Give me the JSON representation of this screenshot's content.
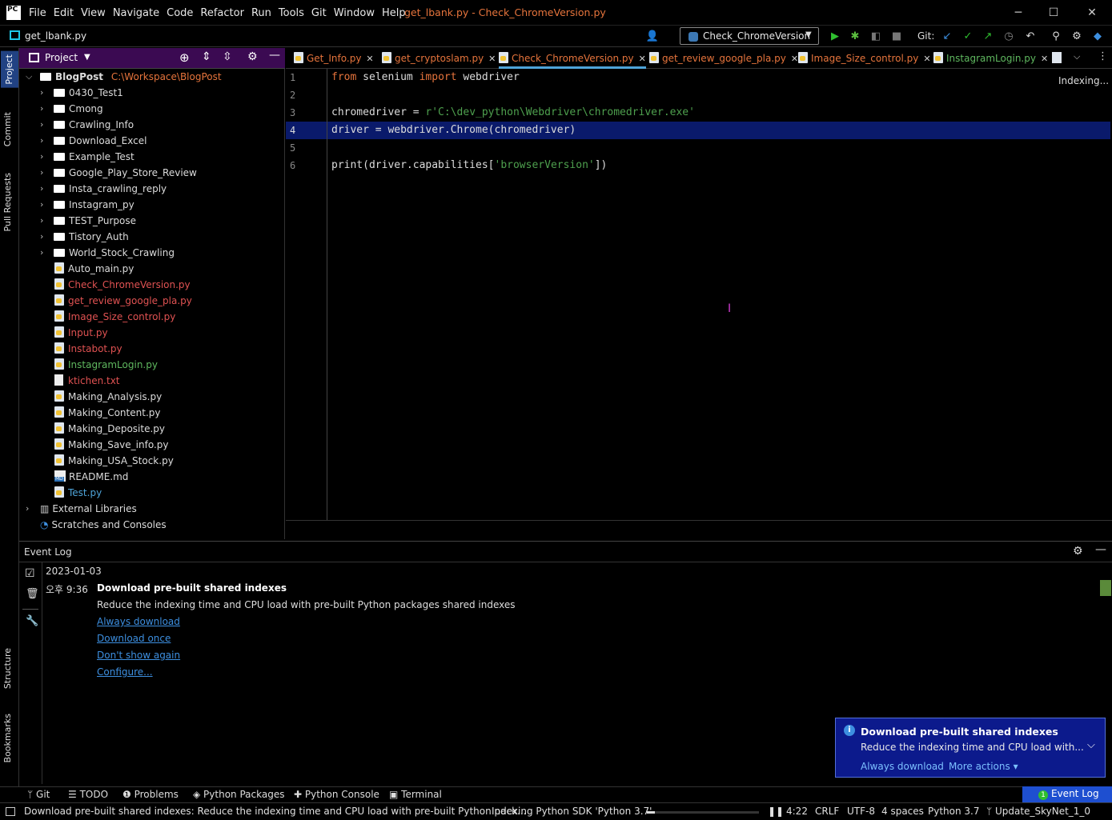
{
  "app": {
    "logo": "PC",
    "window_title": "get_lbank.py - Check_ChromeVersion.py",
    "menu": [
      "File",
      "Edit",
      "View",
      "Navigate",
      "Code",
      "Refactor",
      "Run",
      "Tools",
      "Git",
      "Window",
      "Help"
    ]
  },
  "navbar": {
    "current_file": "get_lbank.py",
    "run_config": "Check_ChromeVersion",
    "git_label": "Git:"
  },
  "left_strip": {
    "project": "Project",
    "commit": "Commit",
    "pull_requests": "Pull Requests",
    "structure": "Structure",
    "bookmarks": "Bookmarks"
  },
  "project_panel": {
    "title": "Project",
    "root_name": "BlogPost",
    "root_path": "C:\\Workspace\\BlogPost",
    "folders": [
      "0430_Test1",
      "Cmong",
      "Crawling_Info",
      "Download_Excel",
      "Example_Test",
      "Google_Play_Store_Review",
      "Insta_crawling_reply",
      "Instagram_py",
      "TEST_Purpose",
      "Tistory_Auth",
      "World_Stock_Crawling"
    ],
    "files": [
      {
        "name": "Auto_main.py",
        "color": "#dcdcdc",
        "kind": "py"
      },
      {
        "name": "Check_ChromeVersion.py",
        "color": "#e05252",
        "kind": "py"
      },
      {
        "name": "get_review_google_pla.py",
        "color": "#e05252",
        "kind": "py"
      },
      {
        "name": "Image_Size_control.py",
        "color": "#e05252",
        "kind": "py"
      },
      {
        "name": "Input.py",
        "color": "#e05252",
        "kind": "py"
      },
      {
        "name": "Instabot.py",
        "color": "#e05252",
        "kind": "py"
      },
      {
        "name": "InstagramLogin.py",
        "color": "#5fb85f",
        "kind": "py"
      },
      {
        "name": "ktichen.txt",
        "color": "#e05252",
        "kind": "txt"
      },
      {
        "name": "Making_Analysis.py",
        "color": "#dcdcdc",
        "kind": "py"
      },
      {
        "name": "Making_Content.py",
        "color": "#dcdcdc",
        "kind": "py"
      },
      {
        "name": "Making_Deposite.py",
        "color": "#dcdcdc",
        "kind": "py"
      },
      {
        "name": "Making_Save_info.py",
        "color": "#dcdcdc",
        "kind": "py"
      },
      {
        "name": "Making_USA_Stock.py",
        "color": "#dcdcdc",
        "kind": "py"
      },
      {
        "name": "README.md",
        "color": "#dcdcdc",
        "kind": "md"
      },
      {
        "name": "Test.py",
        "color": "#4ea4d9",
        "kind": "py"
      }
    ],
    "external_libraries": "External Libraries",
    "scratches": "Scratches and Consoles"
  },
  "editor_tabs": [
    {
      "label": "Get_Info.py",
      "color": "#e6743c"
    },
    {
      "label": "get_cryptoslam.py",
      "color": "#e6743c"
    },
    {
      "label": "Check_ChromeVersion.py",
      "color": "#e6743c",
      "active": true
    },
    {
      "label": "get_review_google_pla.py",
      "color": "#e6743c"
    },
    {
      "label": "Image_Size_control.py",
      "color": "#e6743c"
    },
    {
      "label": "InstagramLogin.py",
      "color": "#5fb85f"
    }
  ],
  "editor": {
    "indexing_label": "Indexing...",
    "line_numbers": [
      "1",
      "2",
      "3",
      "4",
      "5",
      "6"
    ],
    "code": {
      "l1_kw1": "from",
      "l1_mod": " selenium ",
      "l1_kw2": "import",
      "l1_rest": " webdriver",
      "l3_a": "chromedriver = ",
      "l3_str": "r'C:\\dev_python\\Webdriver\\chromedriver.exe'",
      "l4": "driver = webdriver.Chrome(chromedriver)",
      "l6_a": "print(driver.capabilities[",
      "l6_str": "'browserVersion'",
      "l6_b": "])"
    }
  },
  "event_log": {
    "title": "Event Log",
    "date": "2023-01-03",
    "time": "오후 9:36",
    "heading": "Download pre-built shared indexes",
    "body": "Reduce the indexing time and CPU load with pre-built Python packages shared indexes",
    "links": [
      "Always download",
      "Download once",
      "Don't show again",
      "Configure..."
    ]
  },
  "notification": {
    "title": "Download pre-built shared indexes",
    "body": "Reduce the indexing time and CPU load with...",
    "action1": "Always download",
    "action2": "More actions ▾"
  },
  "bottom_tools": [
    "Git",
    "TODO",
    "Problems",
    "Python Packages",
    "Python Console",
    "Terminal"
  ],
  "event_log_button": "Event Log",
  "event_log_badge": "1",
  "status": {
    "message": "Download pre-built shared indexes: Reduce the indexing time and CPU load with pre-built Python pack...",
    "indexing": "Indexing Python SDK 'Python 3.7'",
    "progress": 0.07,
    "position": "4:22",
    "line_sep": "CRLF",
    "encoding": "UTF-8",
    "indent": "4 spaces",
    "interpreter": "Python 3.7",
    "branch": "Update_SkyNet_1_0"
  },
  "colors": {
    "accent": "#4ea4d9",
    "keyword": "#e6743c",
    "string": "#4ea04e",
    "panel_header": "#3b0a52",
    "notification": "#0c1a8c"
  }
}
